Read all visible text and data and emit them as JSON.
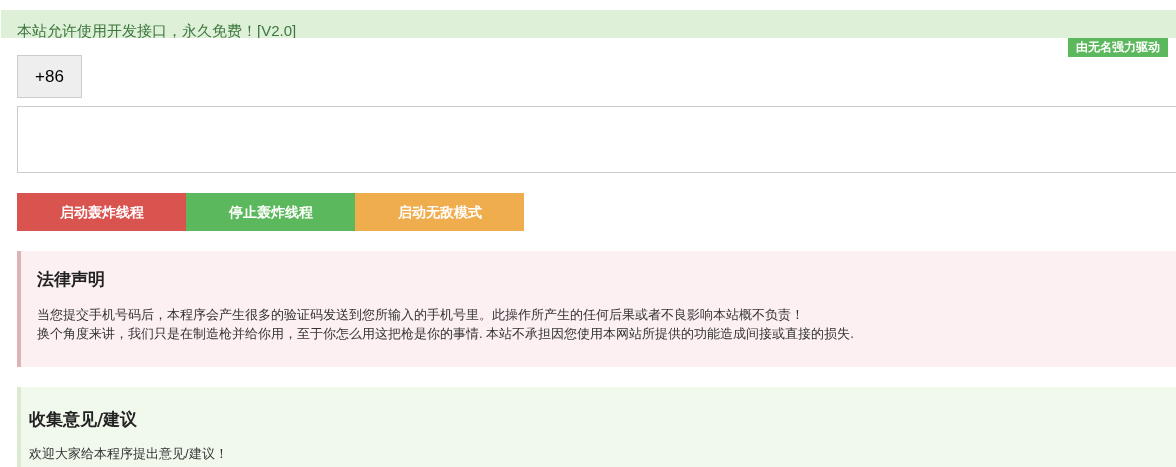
{
  "header": {
    "text": "本站允许使用开发接口，永久免费！[V2.0]"
  },
  "badge": "由无名强力驱动",
  "country_code": "+86",
  "buttons": [
    {
      "label": "启动轰炸线程",
      "color": "#d9534f"
    },
    {
      "label": "停止轰炸线程",
      "color": "#5cb85c"
    },
    {
      "label": "启动无敌模式",
      "color": "#f0ad4e"
    }
  ],
  "notices": [
    {
      "kind": "danger",
      "title": "法律声明",
      "lines": [
        "当您提交手机号码后，本程序会产生很多的验证码发送到您所输入的手机号里。此操作所产生的任何后果或者不良影响本站概不负责！",
        "换个角度来讲，我们只是在制造枪并给你用，至于你怎么用这把枪是你的事情. 本站不承担因您使用本网站所提供的功能造成间接或直接的损失."
      ]
    },
    {
      "kind": "success",
      "title": "收集意见/建议",
      "lines": [
        "欢迎大家给本程序提出意见/建议！"
      ]
    }
  ]
}
